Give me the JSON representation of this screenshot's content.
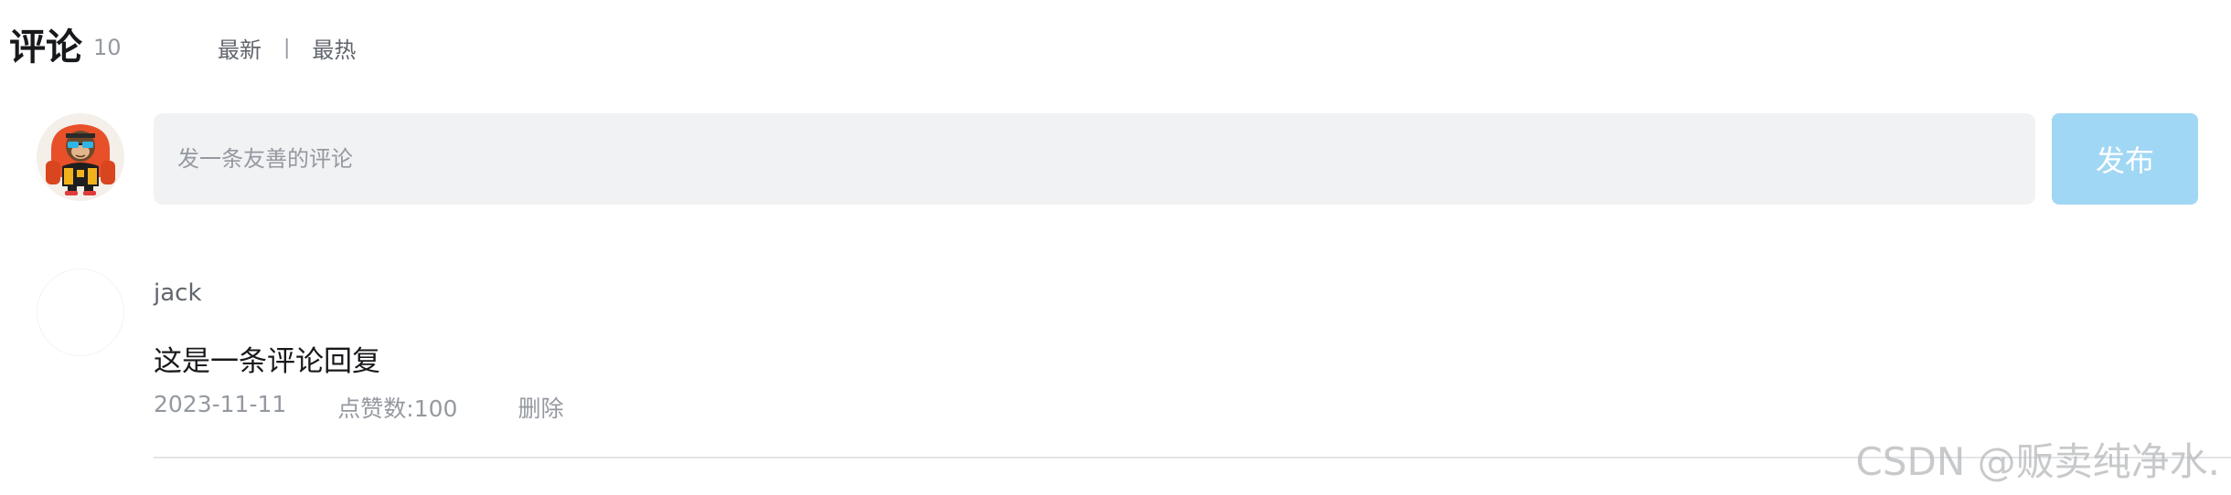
{
  "header": {
    "title": "评论",
    "count": "10",
    "sort_tabs": [
      "最新",
      "最热"
    ],
    "separator": "|"
  },
  "composer": {
    "placeholder": "发一条友善的评论",
    "value": "",
    "publish_label": "发布",
    "avatar_icon": "monkey-avatar-icon"
  },
  "comments": [
    {
      "username": "jack",
      "content": "这是一条评论回复",
      "date": "2023-11-11",
      "likes": "点赞数:100",
      "delete_label": "删除"
    }
  ],
  "watermark": "CSDN @贩卖纯净水.",
  "colors": {
    "publish_bg": "#a0d7f4",
    "input_bg": "#f1f2f3",
    "muted_text": "#9499a0",
    "secondary_text": "#61666d",
    "primary_text": "#18191c"
  }
}
